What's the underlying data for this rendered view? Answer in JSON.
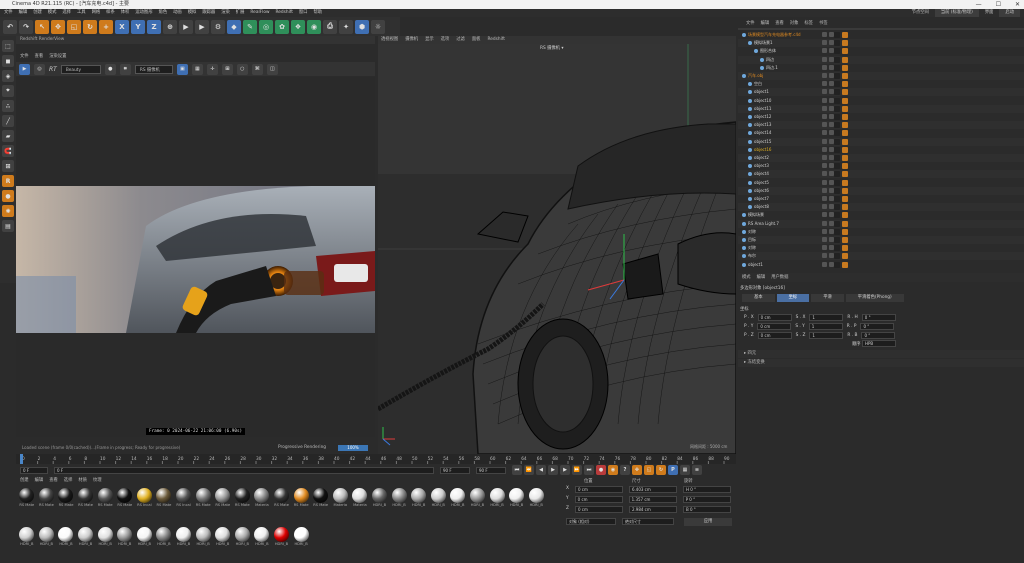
{
  "app": {
    "title": "Cinema 4D R21.115 (RC) - [汽车充电.c4d] - 主要",
    "window_buttons": [
      "—",
      "☐",
      "✕"
    ]
  },
  "menubar": {
    "items": [
      "文件",
      "编辑",
      "创建",
      "模式",
      "选择",
      "工具",
      "网格",
      "样条",
      "体积",
      "运动图形",
      "角色",
      "动画",
      "模拟",
      "跟踪器",
      "渲染",
      "扩展",
      "RealFlow",
      "Redshift",
      "窗口",
      "帮助"
    ],
    "right_label": "节点空间",
    "right_value": "当前 (标准/物理)",
    "layout_label": "界面",
    "layout_value": "启动"
  },
  "toolbar": {
    "icons": [
      {
        "name": "undo-icon",
        "glyph": "↶",
        "c": ""
      },
      {
        "name": "redo-icon",
        "glyph": "↷",
        "c": ""
      },
      {
        "name": "select-icon",
        "glyph": "↖",
        "c": "o"
      },
      {
        "name": "move-icon",
        "glyph": "✥",
        "c": "o"
      },
      {
        "name": "scale-icon",
        "glyph": "◱",
        "c": "o"
      },
      {
        "name": "rotate-icon",
        "glyph": "↻",
        "c": "o"
      },
      {
        "name": "add-icon",
        "glyph": "+",
        "c": "o"
      },
      {
        "name": "x-axis-icon",
        "glyph": "X",
        "c": "b"
      },
      {
        "name": "y-axis-icon",
        "glyph": "Y",
        "c": "b"
      },
      {
        "name": "z-axis-icon",
        "glyph": "Z",
        "c": "b"
      },
      {
        "name": "coordinate-icon",
        "glyph": "⊕",
        "c": ""
      },
      {
        "name": "render-view-icon",
        "glyph": "▶",
        "c": ""
      },
      {
        "name": "render-icon",
        "glyph": "▶",
        "c": ""
      },
      {
        "name": "render-settings-icon",
        "glyph": "⚙",
        "c": ""
      },
      {
        "name": "cube-icon",
        "glyph": "◆",
        "c": "b"
      },
      {
        "name": "pen-icon",
        "glyph": "✎",
        "c": "g"
      },
      {
        "name": "generator-icon",
        "glyph": "◎",
        "c": "g"
      },
      {
        "name": "cloner-icon",
        "glyph": "✿",
        "c": "g"
      },
      {
        "name": "deformer-icon",
        "glyph": "❖",
        "c": "g"
      },
      {
        "name": "scene-icon",
        "glyph": "◉",
        "c": "g"
      },
      {
        "name": "camera-icon",
        "glyph": "⎙",
        "c": ""
      },
      {
        "name": "light-icon",
        "glyph": "✦",
        "c": ""
      },
      {
        "name": "tag-icon",
        "glyph": "⬢",
        "c": "b"
      },
      {
        "name": "sculpt-icon",
        "glyph": "☼",
        "c": ""
      }
    ]
  },
  "left_tools": {
    "icons": [
      "make-editable-icon",
      "model-mode-icon",
      "texture-mode-icon",
      "axis-mode-icon",
      "points-mode-icon",
      "edges-mode-icon",
      "polygons-mode-icon",
      "snap-icon",
      "workplane-icon",
      "redshift-icon",
      "redshift-material-icon",
      "redshift-light-icon",
      "layer-icon"
    ]
  },
  "render_view": {
    "header": "Redshift RenderView",
    "menu": [
      "文件",
      "查看",
      "渲染设置"
    ],
    "rt_label": "RT",
    "mode": "Beauty",
    "camera": "RS 摄像机",
    "frame_info": "Frame: 0   2024-06-22  21:06:00  (6.90s)",
    "status": "Loaded scene (frame 0/0(cached))...(Frame in progress; Ready for progressive)",
    "progressive": "Progressive Rendering",
    "progress": "100%"
  },
  "viewport": {
    "menu": [
      "透视视图",
      "摄像机",
      "显示",
      "选项",
      "过滤",
      "面板",
      "Redshift"
    ],
    "camera": "RS 摄像机 ▾",
    "corner": "网格间距 : 5000 cm",
    "axes": [
      "Y",
      "X",
      "Z"
    ]
  },
  "timeline": {
    "ticks": [
      "0",
      "2",
      "4",
      "6",
      "8",
      "10",
      "12",
      "14",
      "16",
      "18",
      "20",
      "22",
      "24",
      "26",
      "28",
      "30",
      "32",
      "34",
      "36",
      "38",
      "40",
      "42",
      "44",
      "46",
      "48",
      "50",
      "52",
      "54",
      "56",
      "58",
      "60",
      "62",
      "64",
      "66",
      "68",
      "70",
      "72",
      "74",
      "76",
      "78",
      "80",
      "82",
      "84",
      "86",
      "88",
      "90"
    ],
    "start": "0 F",
    "cur": "0 F",
    "end": "90 F",
    "end2": "90 F",
    "frame": "0 F"
  },
  "materials": {
    "menu": [
      "创建",
      "编辑",
      "查看",
      "选择",
      "材质",
      "纹理"
    ],
    "items": [
      {
        "label": "RS Mate",
        "color": "#222"
      },
      {
        "label": "RS Mate",
        "color": "#444"
      },
      {
        "label": "RS Mate",
        "color": "#1a1a1a"
      },
      {
        "label": "RS Mate",
        "color": "#333"
      },
      {
        "label": "RS Mate",
        "color": "#555"
      },
      {
        "label": "RS Mate",
        "color": "#111"
      },
      {
        "label": "RS Incal",
        "color": "#e0b020"
      },
      {
        "label": "RS Mate",
        "color": "#6b5a3a"
      },
      {
        "label": "RS Incal",
        "color": "#555"
      },
      {
        "label": "RS Mate",
        "color": "#777"
      },
      {
        "label": "RS Mate",
        "color": "#999"
      },
      {
        "label": "RS Mate",
        "color": "#222"
      },
      {
        "label": "Materia",
        "color": "#888"
      },
      {
        "label": "RS Mate",
        "color": "#333"
      },
      {
        "label": "RS Mate",
        "color": "#e08a20"
      },
      {
        "label": "RS Mate",
        "color": "#111"
      },
      {
        "label": "Materia",
        "color": "#bbb"
      },
      {
        "label": "Materia",
        "color": "#ddd"
      },
      {
        "label": "HDRI_B",
        "color": "#666"
      },
      {
        "label": "HDRI_B",
        "color": "#888"
      },
      {
        "label": "HDRI_B",
        "color": "#aaa"
      },
      {
        "label": "HDRI_B",
        "color": "#ccc"
      },
      {
        "label": "HDRI_B",
        "color": "#eee"
      },
      {
        "label": "HDRI_B",
        "color": "#999"
      },
      {
        "label": "HDRI_B",
        "color": "#ddd"
      },
      {
        "label": "HDRI_B",
        "color": "#f0f0f0"
      },
      {
        "label": "HDRI_B",
        "color": "#e8e8e8"
      },
      {
        "label": "HDRI_B",
        "color": "#d0d0d0"
      },
      {
        "label": "HDRI_B",
        "color": "#bbb"
      },
      {
        "label": "HDRI_B",
        "color": "#fafafa"
      },
      {
        "label": "HDRI_B",
        "color": "#ccc"
      },
      {
        "label": "HDRI_B",
        "color": "#e0e0e0"
      },
      {
        "label": "HDRI_B",
        "color": "#999"
      },
      {
        "label": "HDRI_B",
        "color": "#f5f5f5"
      },
      {
        "label": "HDRI_B",
        "color": "#888"
      },
      {
        "label": "HDRI_B",
        "color": "#eee"
      },
      {
        "label": "HDRI_B",
        "color": "#bbb"
      },
      {
        "label": "HDRI_B",
        "color": "#ddd"
      },
      {
        "label": "HDRI_B",
        "color": "#aaa"
      },
      {
        "label": "HDRI_B",
        "color": "#eee"
      },
      {
        "label": "HDRI_B",
        "color": "#d00"
      },
      {
        "label": "HDRI_B",
        "color": "#fff"
      }
    ]
  },
  "coords": {
    "hd_pos": "位置",
    "hd_size": "尺寸",
    "hd_rot": "旋转",
    "rows": [
      {
        "a": "X",
        "p": "0 cm",
        "s": "6.403 cm",
        "r": "H  0 °"
      },
      {
        "a": "Y",
        "p": "0 cm",
        "s": "1.357 cm",
        "r": "P  0 °"
      },
      {
        "a": "Z",
        "p": "0 cm",
        "s": "2.984 cm",
        "r": "B  0 °"
      }
    ],
    "mode1": "对象 (相对)",
    "mode2": "绝对尺寸",
    "apply": "应用"
  },
  "objects": {
    "menu": [
      "文件",
      "编辑",
      "查看",
      "对象",
      "标签",
      "书签"
    ],
    "rows": [
      {
        "n": "场景模型汽车充电器参考.c4d",
        "d": 0,
        "c": "#e08a20"
      },
      {
        "n": "模拟场景1",
        "d": 1,
        "c": ""
      },
      {
        "n": "图形合体",
        "d": 2,
        "c": ""
      },
      {
        "n": "四边",
        "d": 3,
        "c": ""
      },
      {
        "n": "四边.1",
        "d": 3,
        "c": ""
      },
      {
        "n": "汽车.obj",
        "d": 0,
        "c": "#e08a20"
      },
      {
        "n": "空白",
        "d": 1,
        "c": ""
      },
      {
        "n": "object1",
        "d": 1,
        "c": ""
      },
      {
        "n": "object10",
        "d": 1,
        "c": ""
      },
      {
        "n": "object11",
        "d": 1,
        "c": ""
      },
      {
        "n": "object12",
        "d": 1,
        "c": ""
      },
      {
        "n": "object13",
        "d": 1,
        "c": ""
      },
      {
        "n": "object14",
        "d": 1,
        "c": ""
      },
      {
        "n": "object15",
        "d": 1,
        "c": ""
      },
      {
        "n": "object16",
        "d": 1,
        "c": "#e0b020"
      },
      {
        "n": "object2",
        "d": 1,
        "c": ""
      },
      {
        "n": "object3",
        "d": 1,
        "c": ""
      },
      {
        "n": "object4",
        "d": 1,
        "c": ""
      },
      {
        "n": "object5",
        "d": 1,
        "c": ""
      },
      {
        "n": "object6",
        "d": 1,
        "c": ""
      },
      {
        "n": "object7",
        "d": 1,
        "c": ""
      },
      {
        "n": "object8",
        "d": 1,
        "c": ""
      },
      {
        "n": "模拟场景",
        "d": 0,
        "c": ""
      },
      {
        "n": "RS Area Light.7",
        "d": 0,
        "c": ""
      },
      {
        "n": "对称",
        "d": 0,
        "c": ""
      },
      {
        "n": "目标",
        "d": 0,
        "c": ""
      },
      {
        "n": "对称",
        "d": 0,
        "c": ""
      },
      {
        "n": "布尔",
        "d": 0,
        "c": ""
      },
      {
        "n": "object1",
        "d": 0,
        "c": ""
      }
    ]
  },
  "attributes": {
    "menu": [
      "模式",
      "编辑",
      "用户数据"
    ],
    "title": "多边形对象 [object16]",
    "tabs": [
      "基本",
      "坐标",
      "平滑",
      "平滑着色(Phong)"
    ],
    "active_tab": 1,
    "section": "坐标",
    "rows": [
      {
        "a": "P . X",
        "v": "0 cm",
        "b": "S . X",
        "w": "1",
        "c": "R . H",
        "x": "0 °"
      },
      {
        "a": "P . Y",
        "v": "0 cm",
        "b": "S . Y",
        "w": "1",
        "c": "R . P",
        "x": "0 °"
      },
      {
        "a": "P . Z",
        "v": "0 cm",
        "b": "S . Z",
        "w": "1",
        "c": "R . B",
        "x": "0 °"
      }
    ],
    "order_label": "顺序",
    "order_value": "HPB",
    "collapse1": "▸ 四元",
    "collapse2": "▸ 冻结变换"
  }
}
